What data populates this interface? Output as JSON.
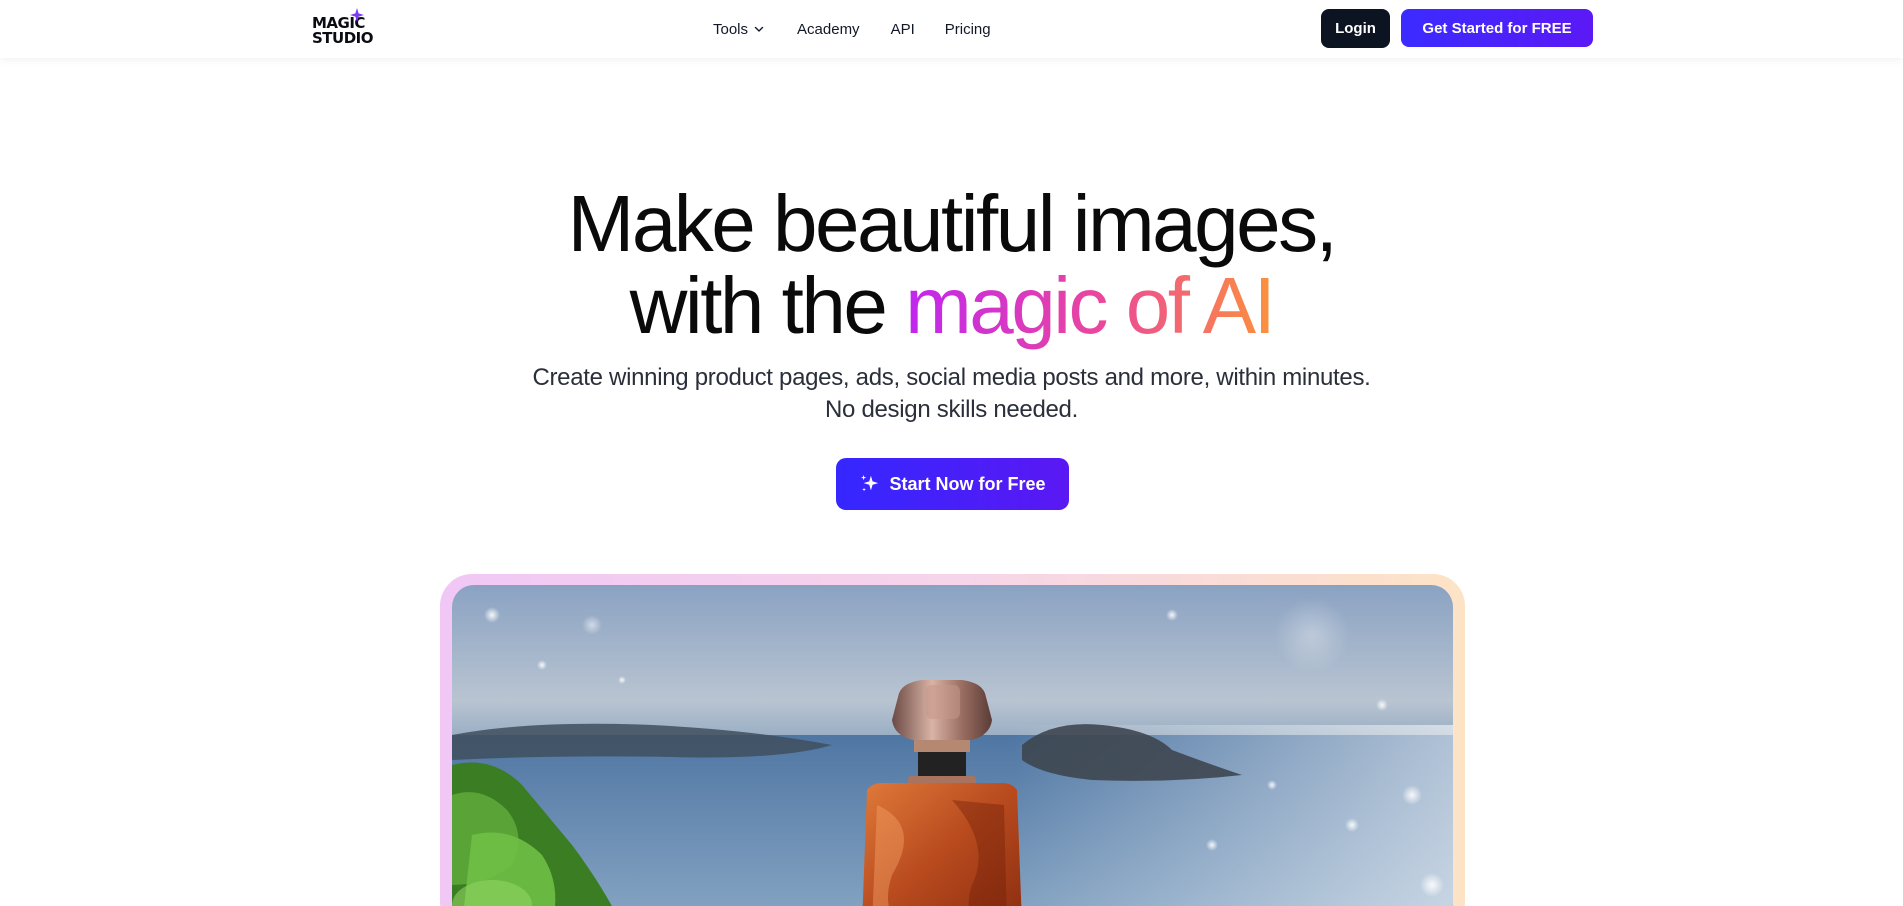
{
  "brand": {
    "logo_line1": "MAGIC",
    "logo_line2": "STUDIO",
    "accent": "#7b3cf5"
  },
  "nav": {
    "items": [
      {
        "label": "Tools",
        "has_dropdown": true
      },
      {
        "label": "Academy"
      },
      {
        "label": "API"
      },
      {
        "label": "Pricing"
      }
    ],
    "login_label": "Login",
    "get_started_label": "Get Started for FREE"
  },
  "hero": {
    "title_line1": "Make beautiful images,",
    "title_line2_plain": "with the ",
    "title_line2_gradient": "magic of AI",
    "subtitle_line1": "Create winning product pages, ads, social media posts and more, within minutes.",
    "subtitle_line2": "No design skills needed.",
    "cta_label": "Start Now for Free"
  },
  "colors": {
    "primary_button": "#3b2bff",
    "dark_button": "#0d1421",
    "gradient_start": "#c026f0",
    "gradient_mid": "#ec4899",
    "gradient_end": "#fb923c"
  },
  "showcase": {
    "icon": "perfume-bottle-image"
  }
}
